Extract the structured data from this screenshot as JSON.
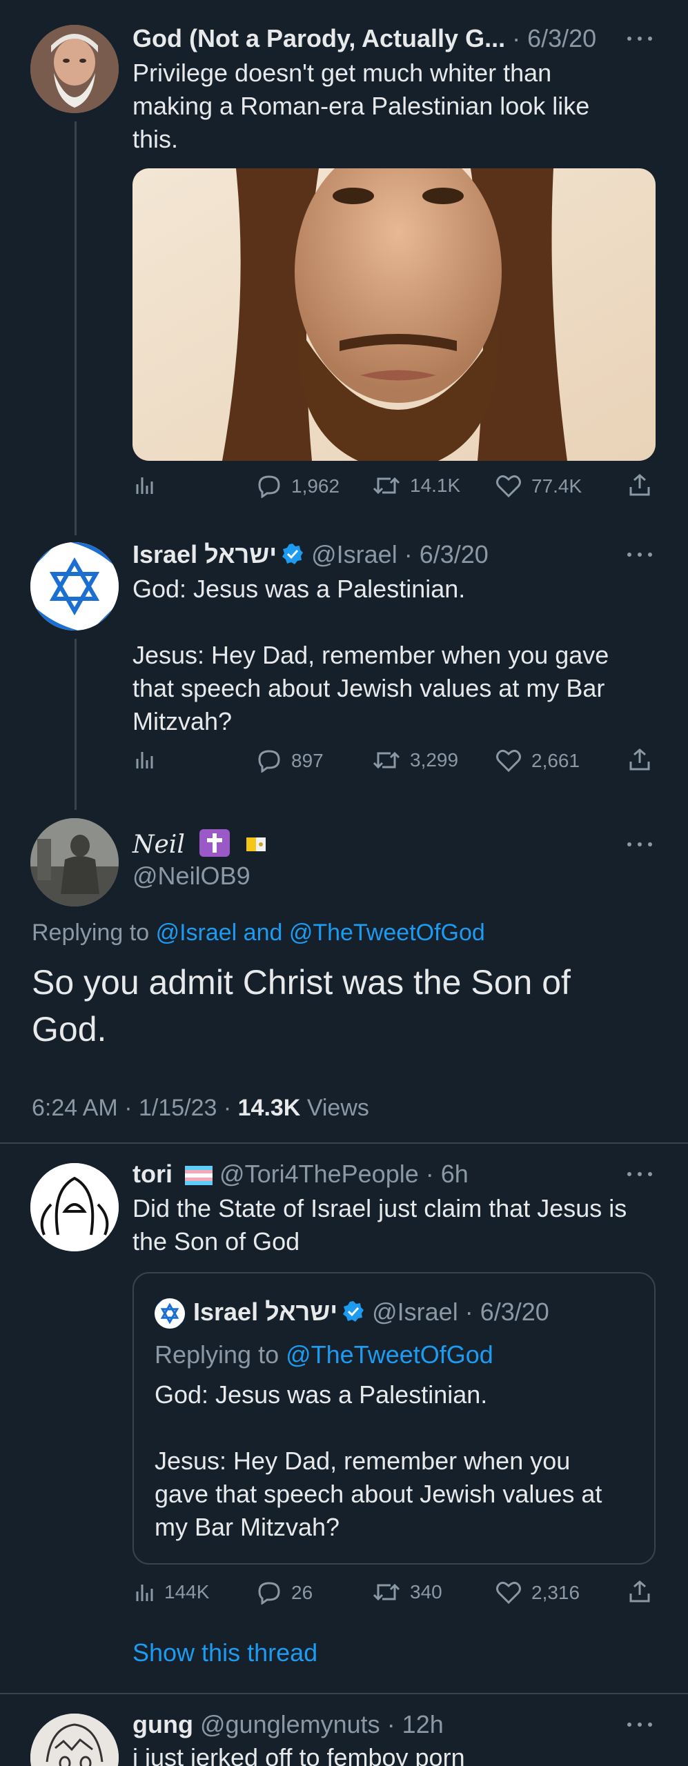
{
  "tweet1": {
    "display_name": "God (Not a Parody, Actually G...",
    "date": "· 6/3/20",
    "text_lines": [
      "Privilege doesn't get much whiter than",
      "making a Roman-era Palestinian look like",
      "this."
    ],
    "replies": "1,962",
    "retweets": "14.1K",
    "likes": "77.4K"
  },
  "tweet2": {
    "display_name": "Israel ישראל",
    "handle": "@Israel",
    "date": "· 6/3/20",
    "text_lines": [
      "God: Jesus was a Palestinian.",
      "",
      "Jesus: Hey Dad, remember when you gave",
      "that speech about Jewish values at my Bar",
      "Mitzvah?"
    ],
    "replies": "897",
    "retweets": "3,299",
    "likes": "2,661"
  },
  "tweet3": {
    "display_name": "Neil",
    "handle": "@NeilOB9",
    "replying_prefix": "Replying to",
    "replying_to": "@Israel and @TheTweetOfGod",
    "text_lines": [
      "So you admit Christ was the Son of",
      "God."
    ],
    "time": "6:24 AM · 1/15/23 ·",
    "views_count": "14.3K",
    "views_label": "Views"
  },
  "tweet4": {
    "display_name": "tori",
    "handle": "@Tori4ThePeople",
    "date": "· 6h",
    "text_lines": [
      "Did the State of Israel just claim that Jesus is",
      "the Son of God"
    ],
    "quote": {
      "display_name": "Israel ישראל",
      "handle": "@Israel",
      "date": "· 6/3/20",
      "replying_prefix": "Replying to",
      "replying_to": "@TheTweetOfGod",
      "text_lines": [
        "God: Jesus was a Palestinian.",
        "",
        "Jesus: Hey Dad, remember when you",
        "gave that speech about Jewish values at",
        "my Bar Mitzvah?"
      ]
    },
    "views": "144K",
    "replies": "26",
    "retweets": "340",
    "likes": "2,316",
    "show_thread": "Show this thread"
  },
  "tweet5": {
    "display_name": "gung",
    "handle": "@gunglemynuts",
    "date": "· 12h",
    "text_lines": [
      "i just jerked off to femboy porn"
    ]
  },
  "colors": {
    "background": "#15202b",
    "link": "#1d9bf0",
    "muted": "#8b98a5",
    "verified": "#1d9bf0"
  }
}
